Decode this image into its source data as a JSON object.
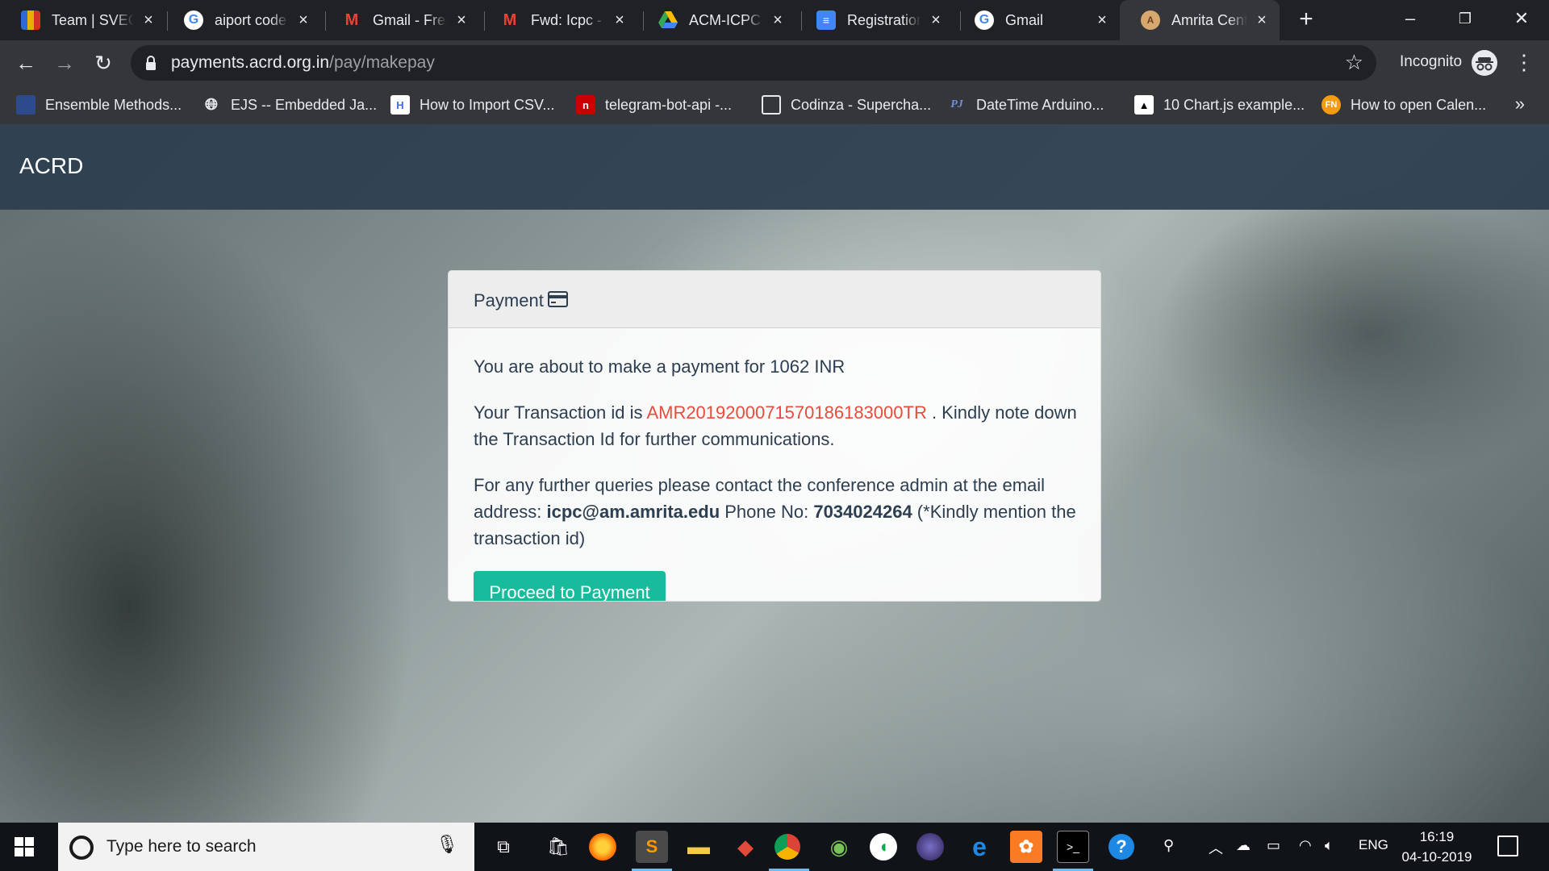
{
  "browser": {
    "tabs": [
      {
        "title": "Team | SVEC",
        "icon": "team-favicon",
        "color": "#e8b000"
      },
      {
        "title": "aiport code l",
        "icon": "google-favicon",
        "color": "#ffffff"
      },
      {
        "title": "Gmail - Free",
        "icon": "gmail-favicon",
        "color": "#ea4335"
      },
      {
        "title": "Fwd: Icpc - s",
        "icon": "gmail-favicon",
        "color": "#ea4335"
      },
      {
        "title": "ACM-ICPC -",
        "icon": "drive-favicon",
        "color": "#fbbc04"
      },
      {
        "title": "Registration",
        "icon": "forms-favicon",
        "color": "#4285f4"
      },
      {
        "title": "Gmail",
        "icon": "google-favicon",
        "color": "#ffffff"
      },
      {
        "title": "Amrita Centr",
        "icon": "amrita-favicon",
        "color": "#d7a86e"
      }
    ],
    "active_tab": 7,
    "url_domain": "payments.acrd.org.in",
    "url_path": "/pay/makepay",
    "mode_label": "Incognito",
    "bookmarks": [
      {
        "label": "Ensemble Methods...",
        "icon": "ensemble-icon"
      },
      {
        "label": "EJS -- Embedded Ja...",
        "icon": "globe-icon"
      },
      {
        "label": "How to Import CSV...",
        "icon": "h-icon"
      },
      {
        "label": "telegram-bot-api -...",
        "icon": "npm-icon"
      },
      {
        "label": "Codinza - Supercha...",
        "icon": "codinza-icon"
      },
      {
        "label": "DateTime Arduino...",
        "icon": "pjrc-icon"
      },
      {
        "label": "10 Chart.js example...",
        "icon": "chartjs-icon"
      },
      {
        "label": "How to open Calen...",
        "icon": "fn-icon"
      }
    ]
  },
  "site": {
    "brand": "ACRD"
  },
  "card": {
    "title": "Payment",
    "amount_text": "You are about to make a payment for 1062 INR",
    "txn_prefix": "Your Transaction id is ",
    "txn_id": "AMR2019200071570186183000TR",
    "txn_suffix": " . Kindly note down the Transaction Id for further communications.",
    "contact_prefix": "For any further queries please contact the conference admin at the email address: ",
    "email": "icpc@am.amrita.edu",
    "phone_label": " Phone No: ",
    "phone": "7034024264",
    "contact_suffix": " (*Kindly mention the transaction id)",
    "button_label": "Proceed to Payment"
  },
  "taskbar": {
    "search_placeholder": "Type here to search",
    "language": "ENG",
    "time": "16:19",
    "date": "04-10-2019"
  }
}
